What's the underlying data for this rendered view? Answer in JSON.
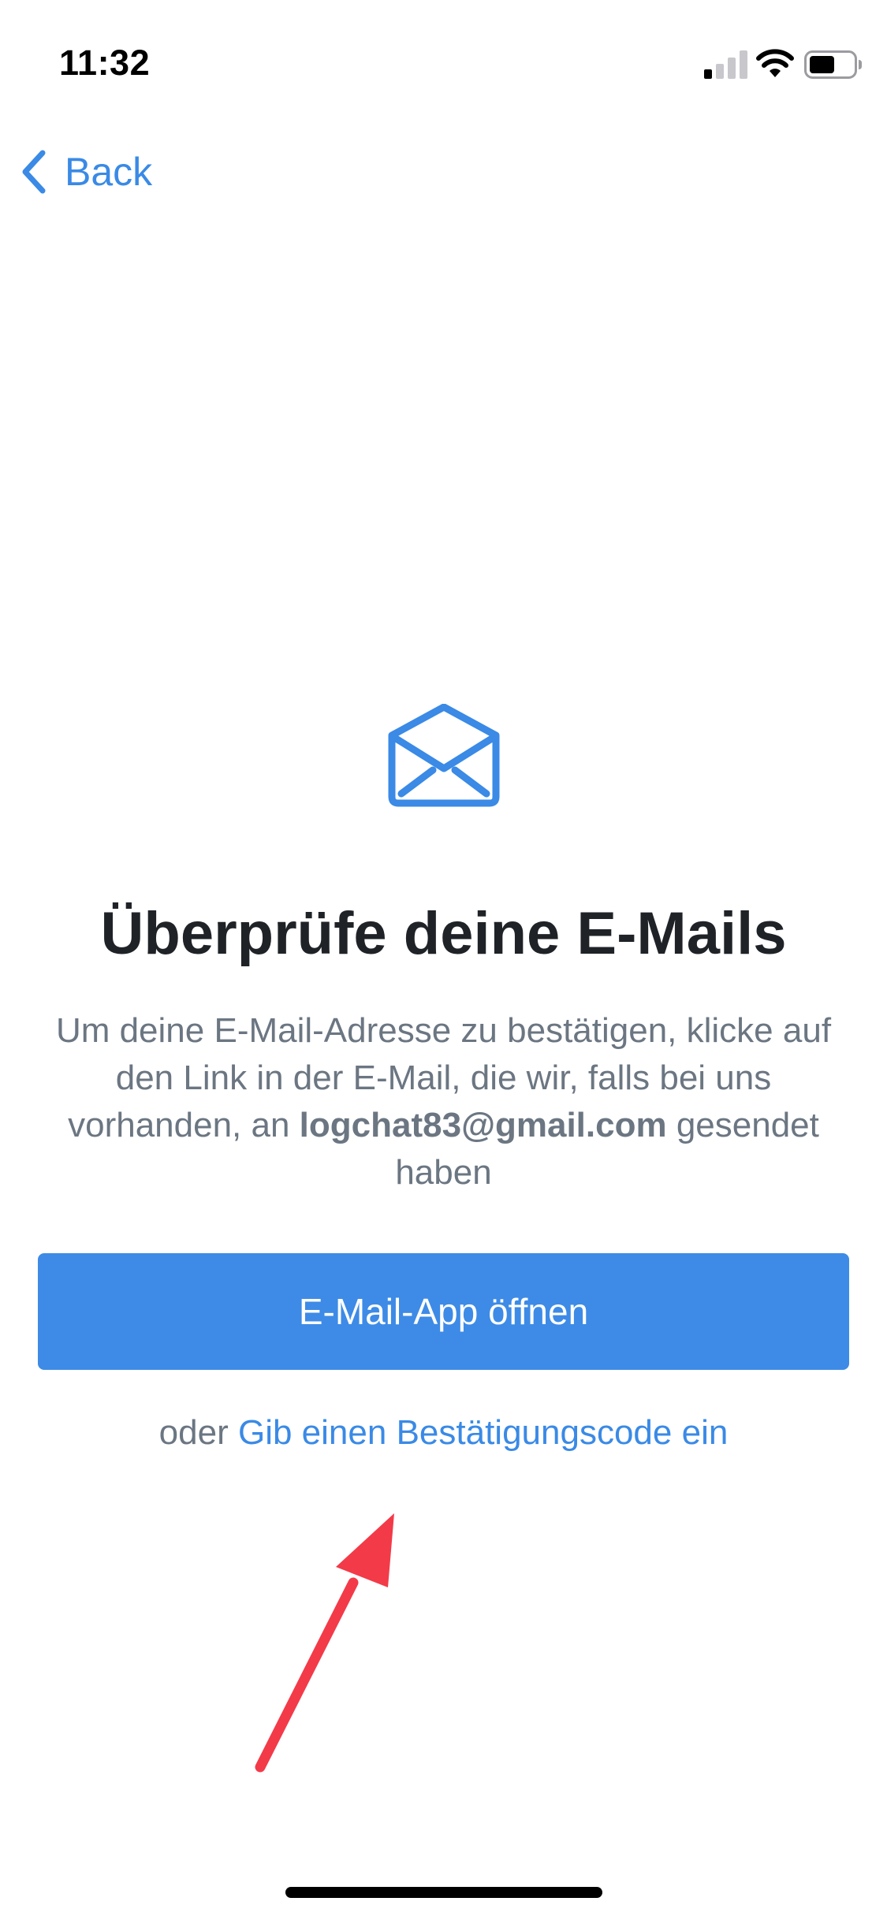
{
  "status_bar": {
    "time": "11:32"
  },
  "nav": {
    "back_label": "Back"
  },
  "content": {
    "title": "Überprüfe deine E-Mails",
    "body_before_email": "Um deine E-Mail-Adresse zu bestätigen, klicke auf den Link in der E-Mail, die wir, falls bei uns vorhanden, an",
    "email": "logchat83@gmail.com",
    "body_after_email": "gesendet haben",
    "primary_button_label": "E-Mail-App öffnen",
    "alt_prefix": "oder",
    "alt_link_label": "Gib einen Bestätigungscode ein"
  },
  "colors": {
    "accent": "#3a8ae6",
    "button": "#3d8be6",
    "title": "#1f2327",
    "body_text": "#6b7682",
    "annotation_arrow": "#f33a48"
  },
  "icons": {
    "back": "chevron-left-icon",
    "mail": "envelope-open-icon",
    "signal": "cellular-signal-icon",
    "wifi": "wifi-icon",
    "battery": "battery-icon"
  }
}
